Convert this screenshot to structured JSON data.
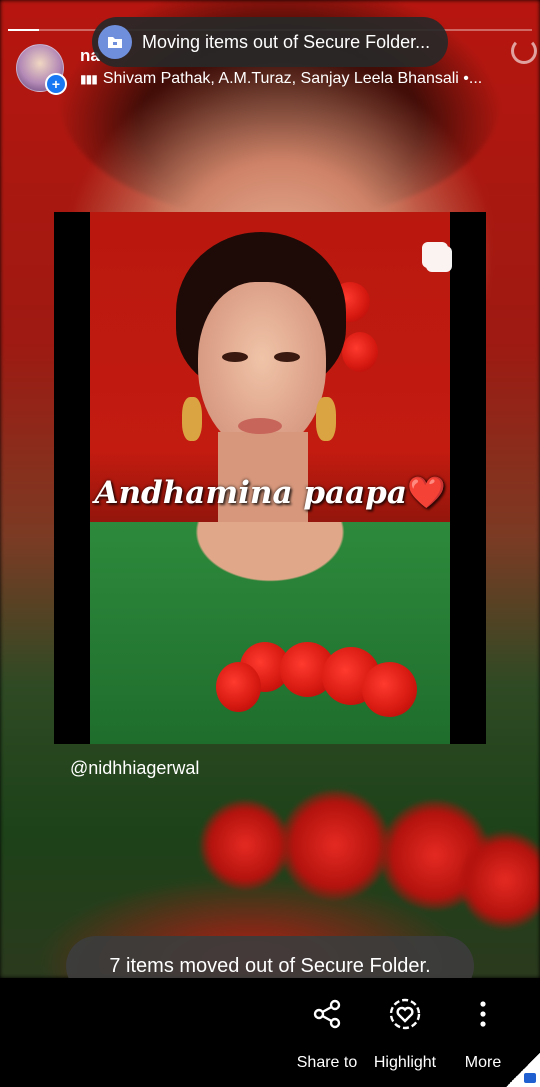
{
  "story": {
    "username": "na",
    "music_text": "Shivam Pathak, A.M.Turaz, Sanjay Leela Bhansali •...",
    "progress_fraction": 0.06,
    "post_caption": "Andhamina paapa",
    "post_heart": "❤️",
    "mention": "@nidhhiagerwal"
  },
  "toasts": {
    "top": "Moving items out of Secure Folder...",
    "bottom": "7 items moved out of Secure Folder."
  },
  "actions": [
    {
      "label": "Share to",
      "icon": "share-icon"
    },
    {
      "label": "Highlight",
      "icon": "highlight-heart-icon"
    },
    {
      "label": "More",
      "icon": "more-vertical-icon"
    }
  ],
  "colors": {
    "folder_badge": "#6f8fdc",
    "avatar_plus": "#1877f2"
  }
}
